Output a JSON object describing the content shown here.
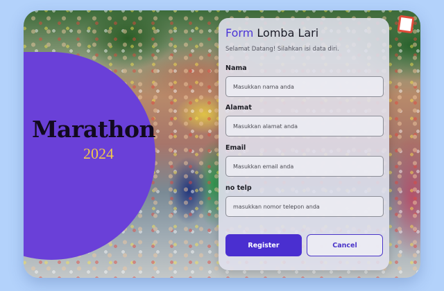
{
  "brand": {
    "title": "Marathon",
    "year": "2024"
  },
  "form": {
    "title_accent": "Form",
    "title_rest": "Lomba Lari",
    "subtitle": "Selamat Datang! Silahkan isi data diri.",
    "fields": [
      {
        "label": "Nama",
        "placeholder": "Masukkan nama anda"
      },
      {
        "label": "Alamat",
        "placeholder": "Masukkan alamat anda"
      },
      {
        "label": "Email",
        "placeholder": "Masukkan email anda"
      },
      {
        "label": "no telp",
        "placeholder": "masukkan nomor telepon anda"
      }
    ],
    "register_label": "Register",
    "cancel_label": "Cancel"
  },
  "colors": {
    "background": "#b3d2fb",
    "purple_panel": "#6a40d8",
    "accent": "#4a2fd0",
    "year_gold": "#f2c94c"
  }
}
